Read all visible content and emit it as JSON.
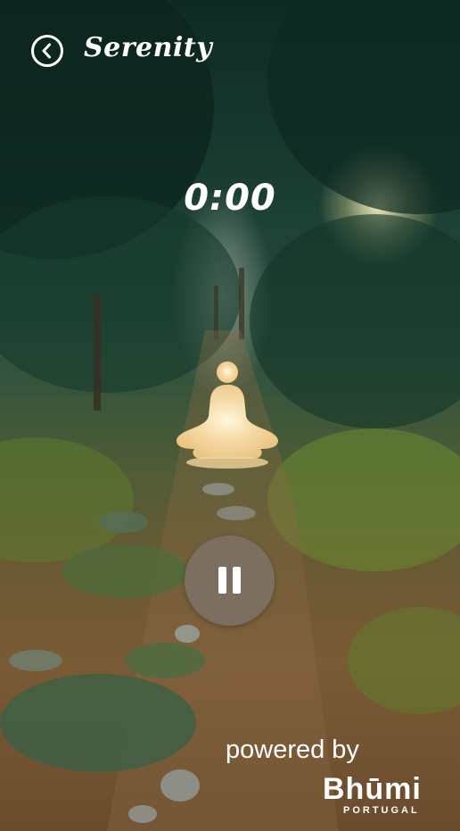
{
  "header": {
    "back_icon": "chevron-left-circle-icon",
    "title": "Serenity"
  },
  "player": {
    "timer": "0:00",
    "meditator_icon": "meditation-person-icon",
    "pause_icon": "pause-icon",
    "state": "playing"
  },
  "footer": {
    "powered_by": "powered by",
    "brand_name": "Bhūmi",
    "brand_subtitle": "PORTUGAL"
  },
  "colors": {
    "pause_button": "#7d6f5f",
    "meditator_glow": "#f3d39a",
    "text": "#ffffff"
  }
}
